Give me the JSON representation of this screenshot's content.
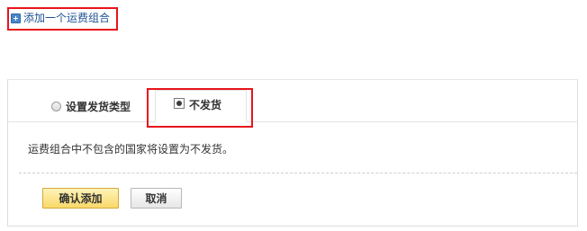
{
  "add_link": {
    "label": "添加一个运费组合",
    "icon": "plus-icon"
  },
  "tabs": [
    {
      "label": "设置发货类型",
      "selected": false
    },
    {
      "label": "不发货",
      "selected": true
    }
  ],
  "info": {
    "text": "运费组合中不包含的国家将设置为不发货。"
  },
  "buttons": {
    "confirm_label": "确认添加",
    "cancel_label": "取消"
  },
  "colors": {
    "link": "#1e5494",
    "highlight_border": "#e8141b",
    "confirm_bg": "#f9d96a"
  }
}
